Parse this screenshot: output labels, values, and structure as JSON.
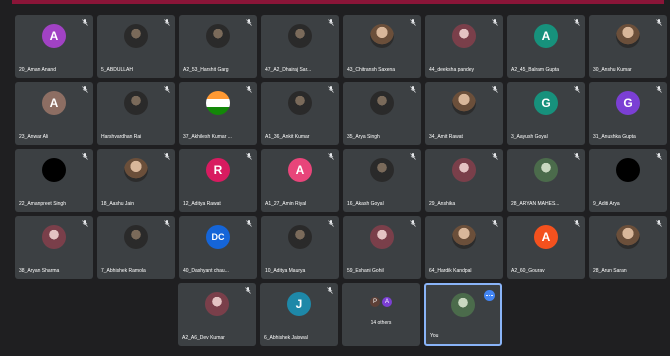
{
  "rows": [
    [
      {
        "name": "20_Aman Anand",
        "avatar": "A",
        "bg": "#a142c4",
        "type": "letter"
      },
      {
        "name": "5_ABDULLAH",
        "type": "photo",
        "style": "dark"
      },
      {
        "name": "A2_53_Harshit Garg",
        "type": "photo",
        "style": "dark"
      },
      {
        "name": "47_A2_Dhairaj Sar...",
        "type": "photo",
        "style": "dark"
      },
      {
        "name": "43_Chitransh Saxena",
        "type": "photo",
        "style": ""
      },
      {
        "name": "44_deeksha pandey",
        "type": "photo",
        "style": "pink"
      },
      {
        "name": "A2_45_Balram Gupta",
        "avatar": "A",
        "bg": "#17917c",
        "type": "letter"
      },
      {
        "name": "30_Anshu Kumar",
        "type": "photo",
        "style": ""
      }
    ],
    [
      {
        "name": "23_Anwar Ali",
        "avatar": "A",
        "bg": "#8d6e63",
        "type": "letter"
      },
      {
        "name": "Harshvardhan Rai",
        "type": "photo",
        "style": "dark"
      },
      {
        "name": "37_Akhilesh Kumar ...",
        "type": "photo",
        "style": "flag"
      },
      {
        "name": "A1_36_Ankit Kumar",
        "type": "photo",
        "style": "dark"
      },
      {
        "name": "35_Arya Singh",
        "type": "photo",
        "style": "dark"
      },
      {
        "name": "34_Amit Rawat",
        "type": "photo",
        "style": ""
      },
      {
        "name": "3_Aayush Goyal",
        "avatar": "G",
        "bg": "#17917c",
        "type": "letter"
      },
      {
        "name": "31_Anushka Gupta",
        "avatar": "G",
        "bg": "#7b3fd4",
        "type": "letter"
      }
    ],
    [
      {
        "name": "22_Amanpreet Singh",
        "type": "photo",
        "style": "black"
      },
      {
        "name": "18_Aashu Jain",
        "type": "photo",
        "style": ""
      },
      {
        "name": "12_Aditya Rawat",
        "avatar": "R",
        "bg": "#d81b60",
        "type": "letter"
      },
      {
        "name": "A1_27_Amin Riyal",
        "avatar": "A",
        "bg": "#e8457a",
        "type": "letter"
      },
      {
        "name": "16_Akash Goyal",
        "type": "photo",
        "style": "dark"
      },
      {
        "name": "29_Anshika",
        "type": "photo",
        "style": "pink"
      },
      {
        "name": "28_ARYAN MAHES...",
        "type": "photo",
        "style": "green"
      },
      {
        "name": "9_Aditi Arya",
        "type": "photo",
        "style": "black"
      }
    ],
    [
      {
        "name": "38_Aryan Sharma",
        "type": "photo",
        "style": "pink"
      },
      {
        "name": "7_Abhishek Ramola",
        "type": "photo",
        "style": "dark"
      },
      {
        "name": "40_Dashyant chau...",
        "avatar": "DC",
        "type": "photo",
        "style": "dc"
      },
      {
        "name": "10_Aditya Maurya",
        "type": "photo",
        "style": "dark"
      },
      {
        "name": "59_Eshani Gohil",
        "type": "photo",
        "style": "pink"
      },
      {
        "name": "64_Hardik Kandpal",
        "type": "photo",
        "style": ""
      },
      {
        "name": "A2_60_Gourav",
        "avatar": "A",
        "bg": "#f4511e",
        "type": "letter"
      },
      {
        "name": "28_Arun Saran",
        "type": "photo",
        "style": ""
      }
    ]
  ],
  "last_row": [
    {
      "name": "A2_A6_Dev Kumar",
      "type": "photo",
      "style": "pink"
    },
    {
      "name": "6_Abhishek Jaiswal",
      "avatar": "J",
      "bg": "#1e88a8",
      "type": "letter"
    },
    {
      "name": "14 others",
      "type": "others",
      "minis": [
        "P",
        "A"
      ],
      "mini_colors": [
        "#5d4037",
        "#7b3fd4"
      ]
    },
    {
      "name": "You",
      "type": "self",
      "style": "green"
    }
  ]
}
